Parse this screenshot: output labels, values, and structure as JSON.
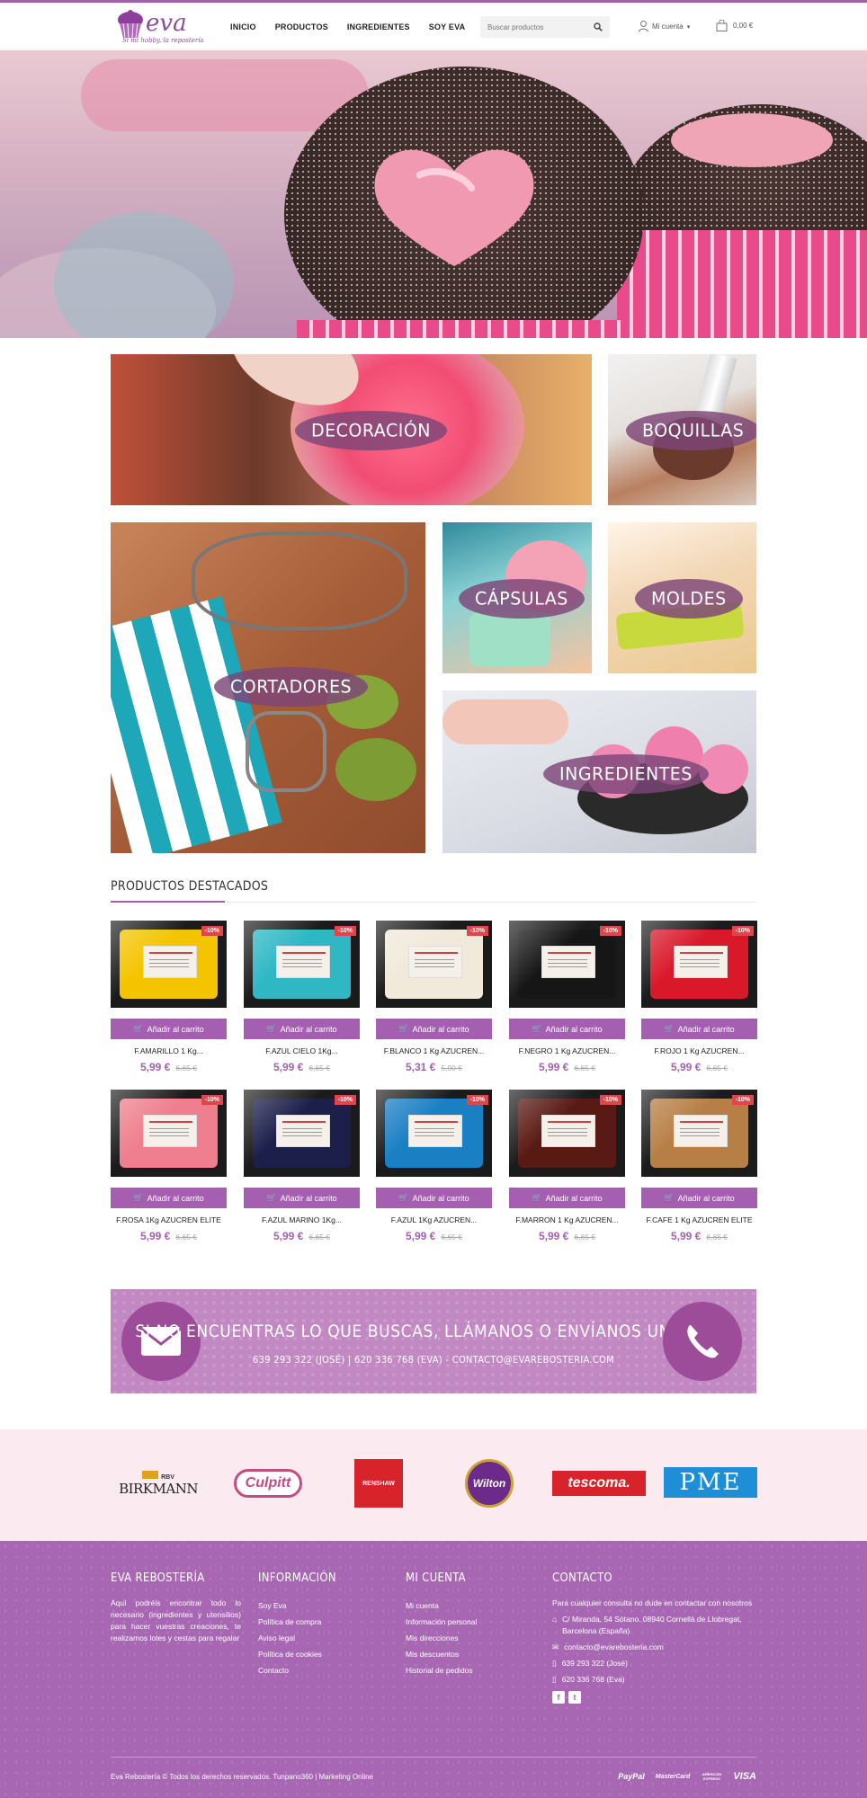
{
  "header": {
    "logo_word": "eva",
    "logo_tagline": "Si mi hobby, la repostería",
    "nav": [
      "INICIO",
      "PRODUCTOS",
      "INGREDIENTES",
      "SOY EVA"
    ],
    "search_placeholder": "Buscar productos",
    "account_label": "Mi cuenta",
    "cart_total": "0,00 €"
  },
  "categories": {
    "decoracion": "DECORACIÓN",
    "boquillas": "BOQUILLAS",
    "cortadores": "CORTADORES",
    "capsulas": "CÁPSULAS",
    "moldes": "MOLDES",
    "ingredientes": "INGREDIENTES"
  },
  "featured": {
    "title": "PRODUCTOS DESTACADOS",
    "add_label": "Añadir al carrito",
    "products": [
      {
        "name": "F.AMARILLO 1 Kg...",
        "price": "5,99 €",
        "old": "6,65 €",
        "badge": "-10%",
        "color": "#f5c400"
      },
      {
        "name": "F.AZUL CIELO 1Kg...",
        "price": "5,99 €",
        "old": "6,65 €",
        "badge": "-10%",
        "color": "#2fb7c4"
      },
      {
        "name": "F.BLANCO 1 Kg AZUCREN...",
        "price": "5,31 €",
        "old": "5,90 €",
        "badge": "-10%",
        "color": "#f1eadb"
      },
      {
        "name": "F.NEGRO 1 Kg AZUCREN...",
        "price": "5,99 €",
        "old": "6,65 €",
        "badge": "-10%",
        "color": "#161616"
      },
      {
        "name": "F.ROJO 1 Kg AZUCREN...",
        "price": "5,99 €",
        "old": "6,65 €",
        "badge": "-10%",
        "color": "#d9182a"
      },
      {
        "name": "F.ROSA 1Kg AZUCREN ELITE",
        "price": "5,99 €",
        "old": "6,65 €",
        "badge": "-10%",
        "color": "#ef7f8e"
      },
      {
        "name": "F.AZUL MARINO 1Kg...",
        "price": "5,99 €",
        "old": "6,65 €",
        "badge": "-10%",
        "color": "#1c1f4a"
      },
      {
        "name": "F.AZUL 1Kg AZUCREN...",
        "price": "5,99 €",
        "old": "6,65 €",
        "badge": "-10%",
        "color": "#1b7fc4"
      },
      {
        "name": "F.MARRON 1 Kg AZUCREN...",
        "price": "5,99 €",
        "old": "6,65 €",
        "badge": "-10%",
        "color": "#5a1a14"
      },
      {
        "name": "F.CAFE 1 Kg AZUCREN ELITE",
        "price": "5,99 €",
        "old": "6,65 €",
        "badge": "-10%",
        "color": "#b77f45"
      }
    ]
  },
  "contact_banner": {
    "headline": "SI NO ENCUENTRAS LO QUE BUSCAS, LLÁMANOS O ENVÍANOS UN E-MAIL",
    "details": "639 293 322 (JOSÉ) | 620 336 768 (EVA) - CONTACTO@EVAREBOSTERIA.COM"
  },
  "brands": [
    "BIRKMANN",
    "RBV",
    "Culpitt",
    "RENSHAW",
    "Wilton",
    "tescoma.",
    "PME"
  ],
  "footer": {
    "about_title": "EVA REBOSTERÍA",
    "about_text": "Aquí podréis encontrar todo lo necesario (ingredientes y utensilios) para hacer vuestras creaciones, te realizamos lotes y cestas para regalar",
    "info_title": "INFORMACIÓN",
    "info_links": [
      "Soy Eva",
      "Política de compra",
      "Aviso legal",
      "Política de cookies",
      "Contacto"
    ],
    "account_title": "MI CUENTA",
    "account_links": [
      "Mi cuenta",
      "Información personal",
      "Mis direcciones",
      "Mis descuentos",
      "Historial de pedidos"
    ],
    "contact_title": "CONTACTO",
    "contact_intro": "Para cualquier consulta no dude en contactar con nosotros",
    "address": "C/ Miranda, 54 Sótano. 08940 Cornellà de Llobregat, Barcelona (España)",
    "email": "contacto@evarebosteria.com",
    "phone1": "639 293 322 (José)",
    "phone2": "620 336 768 (Eva)",
    "copyright": "Eva Rebostería ©   Todos los derechos reservados. Tunpano360 | Marketing Online",
    "payments": [
      "PayPal",
      "MasterCard",
      "AMERICAN EXPRESS",
      "VISA"
    ]
  }
}
